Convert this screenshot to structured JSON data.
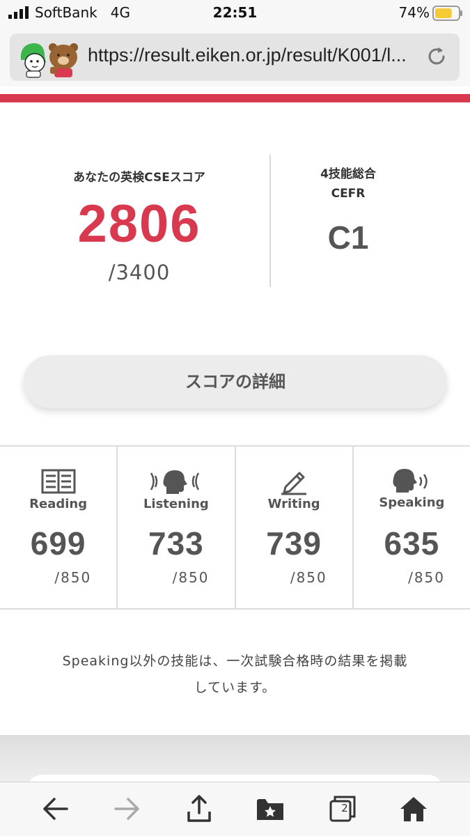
{
  "status": {
    "carrier": "SoftBank",
    "network": "4G",
    "time": "22:51",
    "battery_pct": "74%",
    "battery_level": 0.74
  },
  "browser": {
    "url": "https://result.eiken.or.jp/result/K001/l..."
  },
  "score": {
    "label": "あなたの英検CSEスコア",
    "value": "2806",
    "max": "/3400",
    "cefr_label_line1": "4技能総合",
    "cefr_label_line2": "CEFR",
    "cefr_value": "C1"
  },
  "details_button": "スコアの詳細",
  "skills": [
    {
      "name": "Reading",
      "score": "699",
      "max": "/850",
      "icon": "book-icon"
    },
    {
      "name": "Listening",
      "score": "733",
      "max": "/850",
      "icon": "listening-head-icon"
    },
    {
      "name": "Writing",
      "score": "739",
      "max": "/850",
      "icon": "pencil-icon"
    },
    {
      "name": "Speaking",
      "score": "635",
      "max": "/850",
      "icon": "speaking-head-icon"
    }
  ],
  "note": {
    "line1": "Speaking以外の技能は、一次試験合格時の結果を掲載",
    "line2": "しています。"
  },
  "toolbar": {
    "tab_count": "2"
  },
  "colors": {
    "accent": "#d9394f",
    "text_dark": "#555555",
    "battery": "#f7c935"
  }
}
